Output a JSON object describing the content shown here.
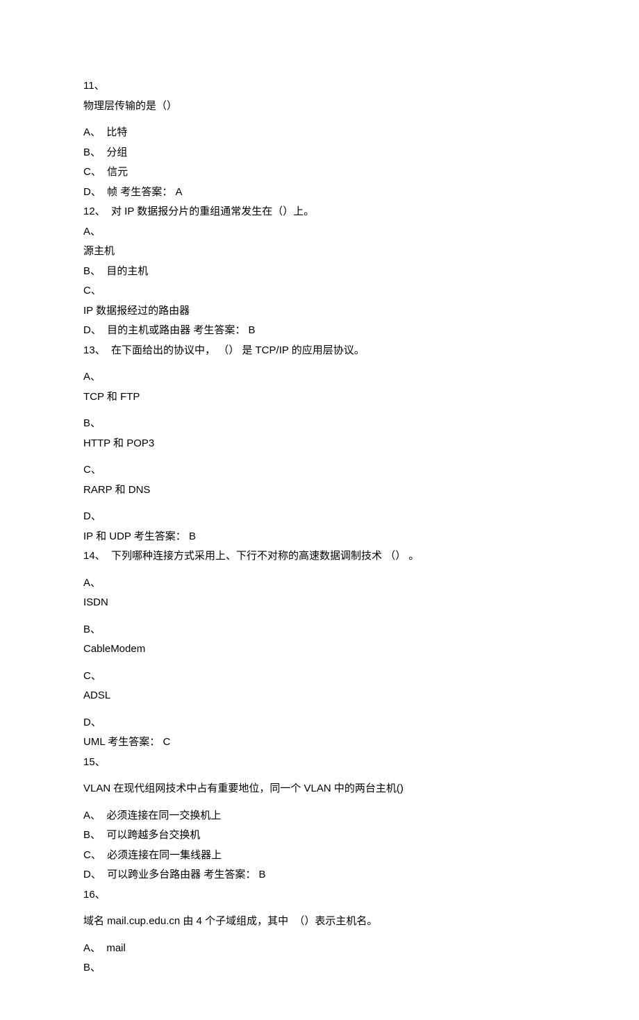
{
  "lines": [
    {
      "text": "11、",
      "gap": false
    },
    {
      "text": "物理层传输的是（）",
      "gap": false
    },
    {
      "text": "A、  比特",
      "gap": true
    },
    {
      "text": "B、  分组",
      "gap": false
    },
    {
      "text": "C、  信元",
      "gap": false
    },
    {
      "text": "D、  帧 考生答案： A",
      "gap": false
    },
    {
      "text": "12、  对 IP 数据报分片的重组通常发生在（）上。",
      "gap": false
    },
    {
      "text": "A、",
      "gap": false
    },
    {
      "text": "源主机",
      "gap": false
    },
    {
      "text": "B、  目的主机",
      "gap": false
    },
    {
      "text": "C、",
      "gap": false
    },
    {
      "text": "IP 数据报经过的路由器",
      "gap": false
    },
    {
      "text": "D、  目的主机或路由器 考生答案： B",
      "gap": false
    },
    {
      "text": "13、  在下面给出的协议中， （） 是 TCP/IP 的应用层协议。",
      "gap": false
    },
    {
      "text": "A、",
      "gap": true
    },
    {
      "text": "TCP 和 FTP",
      "gap": false
    },
    {
      "text": "B、",
      "gap": true
    },
    {
      "text": "HTTP 和 POP3",
      "gap": false
    },
    {
      "text": "C、",
      "gap": true
    },
    {
      "text": "RARP 和 DNS",
      "gap": false
    },
    {
      "text": "D、",
      "gap": true
    },
    {
      "text": "IP 和 UDP 考生答案： B",
      "gap": false
    },
    {
      "text": "14、  下列哪种连接方式采用上、下行不对称的高速数据调制技术 （） 。",
      "gap": false
    },
    {
      "text": "A、",
      "gap": true
    },
    {
      "text": "ISDN",
      "gap": false
    },
    {
      "text": "B、",
      "gap": true
    },
    {
      "text": "CableModem",
      "gap": false
    },
    {
      "text": "C、",
      "gap": true
    },
    {
      "text": "ADSL",
      "gap": false
    },
    {
      "text": "D、",
      "gap": true
    },
    {
      "text": "UML 考生答案： C",
      "gap": false
    },
    {
      "text": "15、",
      "gap": false
    },
    {
      "text": "VLAN 在现代组网技术中占有重要地位，同一个 VLAN 中的两台主机()",
      "gap": true
    },
    {
      "text": "A、  必须连接在同一交换机上",
      "gap": true
    },
    {
      "text": "B、  可以跨越多台交换机",
      "gap": false
    },
    {
      "text": "C、  必须连接在同一集线器上",
      "gap": false
    },
    {
      "text": "D、  可以跨业多台路由器 考生答案： B",
      "gap": false
    },
    {
      "text": "16、",
      "gap": false
    },
    {
      "text": "域名 mail.cup.edu.cn 由 4 个子域组成，其中  （）表示主机名。",
      "gap": true
    },
    {
      "text": "A、  mail",
      "gap": true
    },
    {
      "text": "B、",
      "gap": false
    }
  ]
}
